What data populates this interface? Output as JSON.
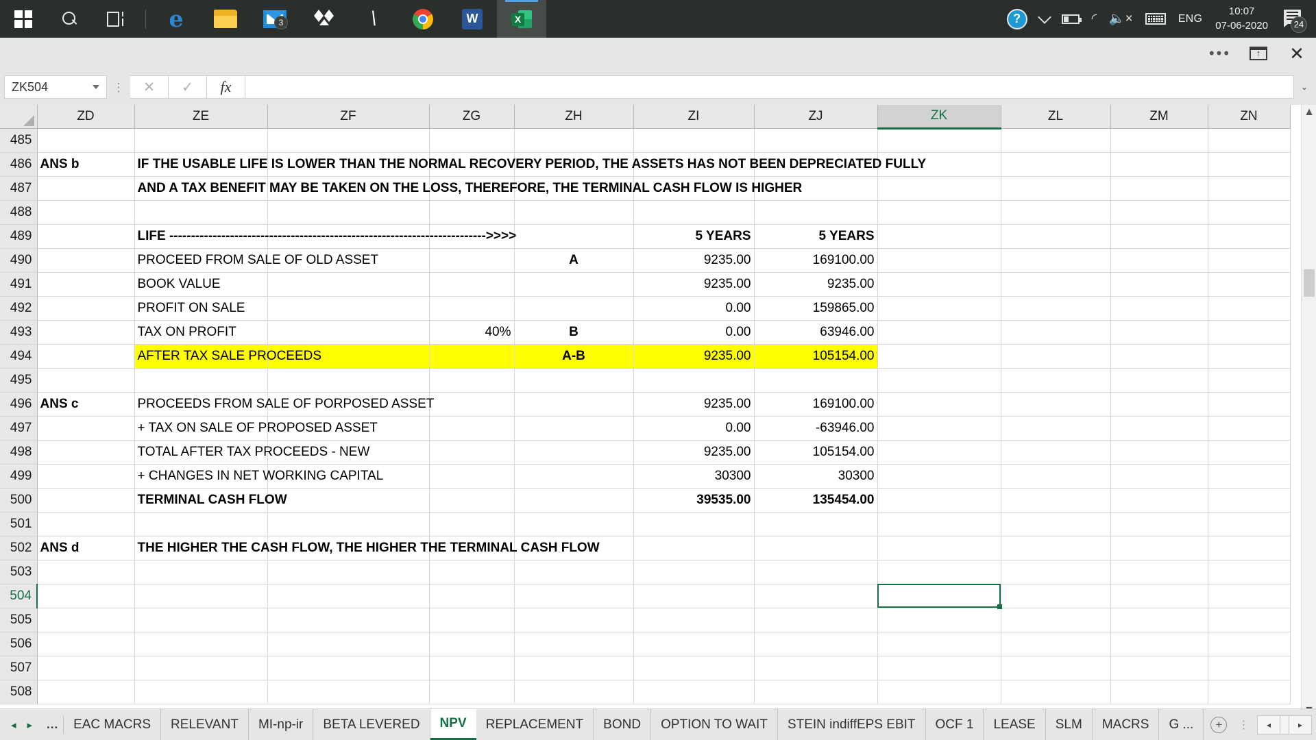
{
  "taskbar": {
    "start_label": "Start",
    "search_label": "Search",
    "taskview_label": "Task View",
    "apps": [
      {
        "name": "edge",
        "label": "Microsoft Edge",
        "badge": null,
        "active": false
      },
      {
        "name": "file-explorer",
        "label": "File Explorer",
        "badge": null,
        "active": false
      },
      {
        "name": "mail",
        "label": "Mail",
        "badge": "3",
        "active": false
      },
      {
        "name": "dropbox",
        "label": "Dropbox",
        "badge": null,
        "active": false
      },
      {
        "name": "bolt-app",
        "label": "Bolt",
        "badge": null,
        "active": false
      },
      {
        "name": "chrome",
        "label": "Google Chrome",
        "badge": null,
        "active": false
      },
      {
        "name": "word",
        "label": "Microsoft Word",
        "badge": "W",
        "active": false
      },
      {
        "name": "excel",
        "label": "Microsoft Excel",
        "badge": "X",
        "active": true
      }
    ],
    "tray": {
      "help_glyph": "?",
      "wifi_glyph": "◜",
      "speaker_glyph": "◁",
      "speaker_mute": "×",
      "language": "ENG",
      "time": "10:07",
      "date": "07-06-2020",
      "notification_count": "24"
    }
  },
  "window": {
    "more_options": "•••",
    "ribbon_display_options": "Ribbon Display Options",
    "close": "✕"
  },
  "formula_bar": {
    "name_box_value": "ZK504",
    "cancel": "✕",
    "enter": "✓",
    "insert_function": "fx",
    "formula_value": "",
    "expand": "⌄"
  },
  "grid": {
    "columns": [
      "ZD",
      "ZE",
      "ZF",
      "ZG",
      "ZH",
      "ZI",
      "ZJ",
      "ZK",
      "ZL",
      "ZM",
      "ZN"
    ],
    "selected_column": "ZK",
    "selected_row": "504",
    "rows": [
      {
        "n": "485",
        "cells": {}
      },
      {
        "n": "486",
        "cells": {
          "ZD": {
            "t": "ANS b",
            "b": true
          },
          "ZE": {
            "t": "IF THE USABLE LIFE IS LOWER THAN THE NORMAL RECOVERY PERIOD, THE ASSETS HAS NOT BEEN DEPRECIATED FULLY",
            "b": true,
            "span": true
          }
        }
      },
      {
        "n": "487",
        "cells": {
          "ZE": {
            "t": "AND A TAX BENEFIT MAY BE TAKEN ON THE LOSS, THEREFORE,  THE TERMINAL CASH FLOW IS HIGHER",
            "b": true,
            "span": true
          }
        }
      },
      {
        "n": "488",
        "cells": {}
      },
      {
        "n": "489",
        "cells": {
          "ZE": {
            "t": "LIFE ------------------------------------------------------------------------->>>>",
            "b": true,
            "span": true
          },
          "ZI": {
            "t": "5 YEARS",
            "b": true,
            "a": "r"
          },
          "ZJ": {
            "t": "5 YEARS",
            "b": true,
            "a": "r"
          }
        }
      },
      {
        "n": "490",
        "cells": {
          "ZE": {
            "t": "PROCEED FROM SALE OF OLD ASSET",
            "span": true
          },
          "ZH": {
            "t": "A",
            "b": true,
            "a": "c"
          },
          "ZI": {
            "t": "9235.00",
            "a": "r"
          },
          "ZJ": {
            "t": "169100.00",
            "a": "r"
          }
        }
      },
      {
        "n": "491",
        "cells": {
          "ZE": {
            "t": "BOOK VALUE"
          },
          "ZI": {
            "t": "9235.00",
            "a": "r"
          },
          "ZJ": {
            "t": "9235.00",
            "a": "r"
          }
        }
      },
      {
        "n": "492",
        "cells": {
          "ZE": {
            "t": "PROFIT ON SALE",
            "span": true
          },
          "ZI": {
            "t": "0.00",
            "a": "r"
          },
          "ZJ": {
            "t": "159865.00",
            "a": "r"
          }
        }
      },
      {
        "n": "493",
        "cells": {
          "ZE": {
            "t": "TAX ON PROFIT",
            "span": true
          },
          "ZG": {
            "t": "40%",
            "a": "r"
          },
          "ZH": {
            "t": "B",
            "b": true,
            "a": "c"
          },
          "ZI": {
            "t": "0.00",
            "a": "r"
          },
          "ZJ": {
            "t": "63946.00",
            "a": "r"
          }
        }
      },
      {
        "n": "494",
        "hl": true,
        "cells": {
          "ZE": {
            "t": "AFTER TAX SALE PROCEEDS",
            "span": true
          },
          "ZH": {
            "t": "A-B",
            "b": true,
            "a": "c"
          },
          "ZI": {
            "t": "9235.00",
            "a": "r"
          },
          "ZJ": {
            "t": "105154.00",
            "a": "r"
          }
        }
      },
      {
        "n": "495",
        "cells": {}
      },
      {
        "n": "496",
        "cells": {
          "ZD": {
            "t": "ANS c",
            "b": true
          },
          "ZE": {
            "t": "PROCEEDS FROM SALE OF PORPOSED ASSET",
            "span": true
          },
          "ZI": {
            "t": "9235.00",
            "a": "r"
          },
          "ZJ": {
            "t": "169100.00",
            "a": "r"
          }
        }
      },
      {
        "n": "497",
        "cells": {
          "ZE": {
            "t": " + TAX ON SALE OF PROPOSED ASSET",
            "span": true
          },
          "ZI": {
            "t": "0.00",
            "a": "r"
          },
          "ZJ": {
            "t": "-63946.00",
            "a": "r"
          }
        }
      },
      {
        "n": "498",
        "cells": {
          "ZE": {
            "t": "TOTAL AFTER TAX PROCEEDS - NEW",
            "span": true
          },
          "ZI": {
            "t": "9235.00",
            "a": "r"
          },
          "ZJ": {
            "t": "105154.00",
            "a": "r"
          }
        }
      },
      {
        "n": "499",
        "cells": {
          "ZE": {
            "t": " + CHANGES IN NET WORKING CAPITAL",
            "span": true
          },
          "ZI": {
            "t": "30300",
            "a": "r"
          },
          "ZJ": {
            "t": "30300",
            "a": "r"
          }
        }
      },
      {
        "n": "500",
        "cells": {
          "ZE": {
            "t": "TERMINAL CASH FLOW",
            "b": true,
            "span": true
          },
          "ZI": {
            "t": "39535.00",
            "b": true,
            "a": "r"
          },
          "ZJ": {
            "t": "135454.00",
            "b": true,
            "a": "r"
          }
        }
      },
      {
        "n": "501",
        "cells": {}
      },
      {
        "n": "502",
        "cells": {
          "ZD": {
            "t": "ANS d",
            "b": true
          },
          "ZE": {
            "t": "THE HIGHER THE CASH FLOW, THE HIGHER THE TERMINAL CASH FLOW",
            "b": true,
            "span": true
          }
        }
      },
      {
        "n": "503",
        "cells": {}
      },
      {
        "n": "504",
        "sel": true,
        "cells": {}
      },
      {
        "n": "505",
        "cells": {}
      },
      {
        "n": "506",
        "cells": {}
      },
      {
        "n": "507",
        "cells": {}
      },
      {
        "n": "508",
        "cells": {}
      }
    ]
  },
  "sheet_tabs": {
    "first_arrow": "◂",
    "last_arrow": "▸",
    "overflow": "…",
    "tabs": [
      {
        "label": "EAC MACRS",
        "active": false
      },
      {
        "label": "RELEVANT",
        "active": false
      },
      {
        "label": "MI-np-ir",
        "active": false
      },
      {
        "label": "BETA LEVERED",
        "active": false
      },
      {
        "label": "NPV",
        "active": true
      },
      {
        "label": "REPLACEMENT",
        "active": false
      },
      {
        "label": "BOND",
        "active": false
      },
      {
        "label": "OPTION TO WAIT",
        "active": false
      },
      {
        "label": "STEIN indiffEPS EBIT",
        "active": false
      },
      {
        "label": "OCF 1",
        "active": false
      },
      {
        "label": "LEASE",
        "active": false
      },
      {
        "label": "SLM",
        "active": false
      },
      {
        "label": "MACRS",
        "active": false
      },
      {
        "label": "G ...",
        "active": false
      }
    ],
    "add_sheet": "+",
    "scroll_left": "◂",
    "scroll_right": "▸"
  },
  "colors": {
    "excel_green": "#137045",
    "highlight_yellow": "#ffff00",
    "taskbar_bg": "#2b2f2c"
  }
}
